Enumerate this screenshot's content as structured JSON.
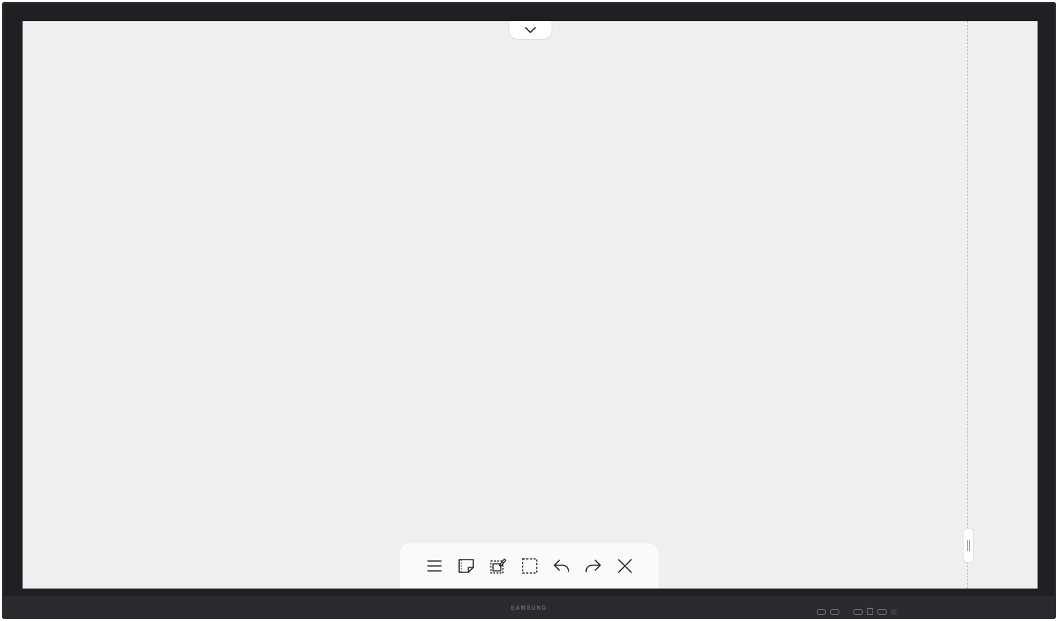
{
  "display": {
    "brand": "SAMSUNG"
  },
  "top_panel": {
    "icon": "chevron-down-icon"
  },
  "side_handle": {
    "icon": "drag-handle-icon"
  },
  "toolbar": {
    "tools": [
      {
        "name": "menu",
        "icon": "menu-icon"
      },
      {
        "name": "sticky-note",
        "icon": "sticky-note-icon"
      },
      {
        "name": "import",
        "icon": "import-icon"
      },
      {
        "name": "select",
        "icon": "select-icon"
      },
      {
        "name": "undo",
        "icon": "undo-icon"
      },
      {
        "name": "redo",
        "icon": "redo-icon"
      },
      {
        "name": "close",
        "icon": "close-icon"
      }
    ]
  },
  "colors": {
    "bezel": "#1f2023",
    "canvas": "#efefef",
    "toolbar": "#fafafa",
    "icon": "#222222"
  }
}
